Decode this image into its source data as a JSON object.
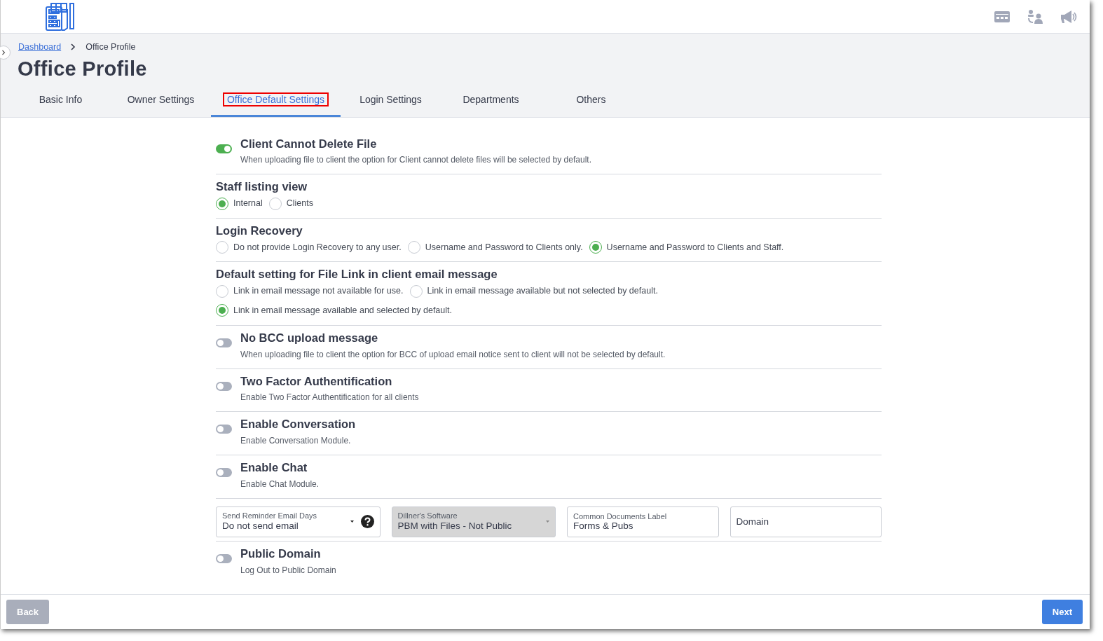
{
  "breadcrumb": [
    {
      "label": "Dashboard",
      "link": true
    },
    {
      "label": "Office Profile",
      "link": false
    }
  ],
  "title": "Office Profile",
  "tabs": [
    {
      "label": "Basic Info",
      "selected": false
    },
    {
      "label": "Owner Settings",
      "selected": false
    },
    {
      "label": "Office Default Settings",
      "selected": true
    },
    {
      "label": "Login Settings",
      "selected": false
    },
    {
      "label": "Departments",
      "selected": false
    },
    {
      "label": "Others",
      "selected": false
    }
  ],
  "settings": [
    {
      "kind": "toggle",
      "title": "Client Cannot Delete File",
      "description": "When uploading file to client the option for Client cannot delete files will be selected by default.",
      "on": true
    },
    {
      "kind": "radio",
      "title": "Staff listing view",
      "options": [
        {
          "label": "Internal",
          "selected": true
        },
        {
          "label": "Clients",
          "selected": false
        }
      ]
    },
    {
      "kind": "radio",
      "title": "Login Recovery",
      "options": [
        {
          "label": "Do not provide Login Recovery to any user.",
          "selected": false
        },
        {
          "label": "Username and Password to Clients only.",
          "selected": false
        },
        {
          "label": "Username and Password to Clients and Staff.",
          "selected": true
        }
      ]
    },
    {
      "kind": "radio",
      "title": "Default setting for File Link in client email message",
      "options": [
        {
          "label": "Link in email message not available for use.",
          "selected": false
        },
        {
          "label": "Link in email message available but not selected by default.",
          "selected": false
        },
        {
          "label": "Link in email message available and selected by default.",
          "selected": true
        }
      ]
    },
    {
      "kind": "toggle",
      "title": "No BCC upload message",
      "description": "When uploading file to client the option for BCC of upload email notice sent to client will not be selected by default.",
      "on": false
    },
    {
      "kind": "toggle",
      "title": "Two Factor Authentification",
      "description": "Enable Two Factor Authentification for all clients",
      "on": false
    },
    {
      "kind": "toggle",
      "title": "Enable Conversation",
      "description": "Enable Conversation Module.",
      "on": false
    },
    {
      "kind": "toggle",
      "title": "Enable Chat",
      "description": "Enable Chat Module.",
      "on": false
    }
  ],
  "fields": [
    {
      "kind": "select",
      "label": "Send Reminder Email Days",
      "value": "Do not send email",
      "help": true,
      "disabled": false
    },
    {
      "kind": "select",
      "label": "Dillner's Software",
      "value": "PBM with Files - Not Public",
      "help": false,
      "disabled": true
    },
    {
      "kind": "input",
      "label": "Common Documents Label",
      "value": "Forms & Pubs"
    },
    {
      "kind": "input",
      "placeholder": "Domain"
    }
  ],
  "public_domain": {
    "title": "Public Domain",
    "description": "Log Out to Public Domain",
    "on": false
  },
  "footer": {
    "back": {
      "label": "Back",
      "disabled": true
    },
    "next": {
      "label": "Next",
      "disabled": false
    }
  }
}
